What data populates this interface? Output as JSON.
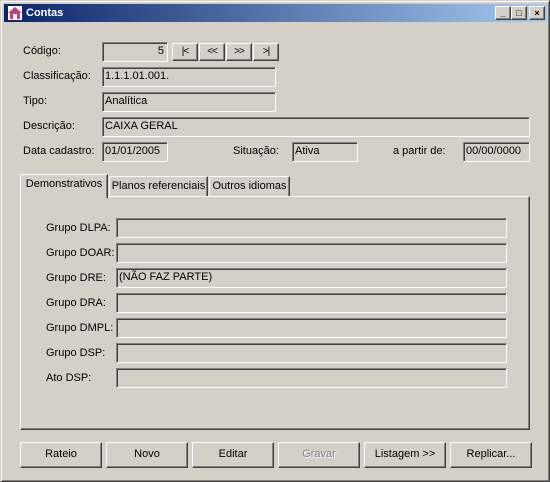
{
  "window": {
    "title": "Contas"
  },
  "titlebar_buttons": {
    "minimize": "_",
    "maximize": "□",
    "close": "×"
  },
  "form": {
    "codigo_label": "Código:",
    "codigo_value": "5",
    "classificacao_label": "Classificação:",
    "classificacao_value": "1.1.1.01.001.",
    "tipo_label": "Tipo:",
    "tipo_value": "Analítica",
    "descricao_label": "Descrição:",
    "descricao_value": "CAIXA GERAL",
    "data_cadastro_label": "Data cadastro:",
    "data_cadastro_value": "01/01/2005",
    "situacao_label": "Situação:",
    "situacao_value": "Ativa",
    "a_partir_label": "a partir de:",
    "a_partir_value": "00/00/0000"
  },
  "nav": {
    "first": "|<",
    "prev": "<<",
    "next": ">>",
    "last": ">|"
  },
  "tabs": [
    {
      "label": "Demonstrativos"
    },
    {
      "label": "Planos referenciais"
    },
    {
      "label": "Outros idiomas"
    }
  ],
  "demonstrativos": [
    {
      "label": "Grupo DLPA:",
      "value": ""
    },
    {
      "label": "Grupo DOAR:",
      "value": ""
    },
    {
      "label": "Grupo DRE:",
      "value": "(NÃO FAZ PARTE)"
    },
    {
      "label": "Grupo DRA:",
      "value": ""
    },
    {
      "label": "Grupo DMPL:",
      "value": ""
    },
    {
      "label": "Grupo DSP:",
      "value": ""
    },
    {
      "label": "Ato DSP:",
      "value": ""
    }
  ],
  "buttons": {
    "rateio": "Rateio",
    "novo": "Novo",
    "editar": "Editar",
    "gravar": "Gravar",
    "listagem": "Listagem >>",
    "replicar": "Replicar..."
  }
}
